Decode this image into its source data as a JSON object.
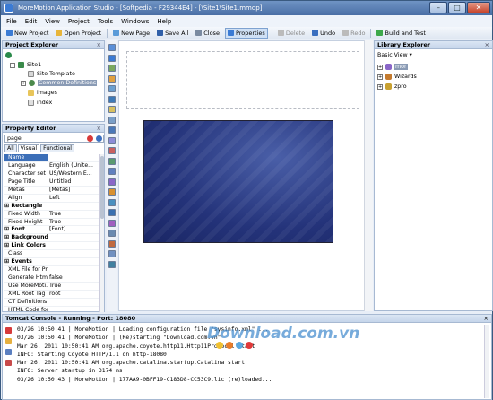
{
  "window": {
    "title": "MoreMotion Application Studio - [Softpedia - F29344E4] - [\\Site1\\Site1.mmdp]"
  },
  "menu": [
    "File",
    "Edit",
    "View",
    "Project",
    "Tools",
    "Windows",
    "Help"
  ],
  "toolbar": [
    {
      "label": "New Project",
      "icon": "new-project-icon",
      "color": "#3b7bd4"
    },
    {
      "label": "Open Project",
      "icon": "open-project-icon",
      "color": "#e8b53a"
    },
    {
      "label": "New Page",
      "icon": "new-page-icon",
      "color": "#5a9bd8"
    },
    {
      "label": "Save All",
      "icon": "save-all-icon",
      "color": "#2f5fa8"
    },
    {
      "label": "Close",
      "icon": "close-doc-icon",
      "color": "#7a8aa0"
    },
    {
      "label": "Properties",
      "icon": "properties-icon",
      "color": "#3b7bd4",
      "active": true
    },
    {
      "label": "Delete",
      "icon": "delete-icon",
      "color": "#bbbbbb",
      "disabled": true
    },
    {
      "label": "Undo",
      "icon": "undo-icon",
      "color": "#3a6fbf"
    },
    {
      "label": "Redo",
      "icon": "redo-icon",
      "color": "#bbbbbb",
      "disabled": true
    },
    {
      "label": "Build and Test",
      "icon": "build-test-icon",
      "color": "#3da84a"
    }
  ],
  "project_explorer": {
    "title": "Project Explorer",
    "close": "×",
    "nodes": [
      {
        "label": "",
        "icon": "globe-icon",
        "color": "#2a8a4a"
      },
      {
        "label": "Site1",
        "icon": "site-icon",
        "color": "#3a8a4a"
      },
      {
        "label": "Site Template",
        "icon": "template-icon",
        "color": "#d8d8d8"
      },
      {
        "label": "Common Definitions",
        "icon": "definitions-icon",
        "color": "#4c8a4c",
        "selected": true
      },
      {
        "label": "images",
        "icon": "folder-icon",
        "color": "#e8c55a"
      },
      {
        "label": "index",
        "icon": "page-icon",
        "color": "#e0e0e0"
      }
    ]
  },
  "property_editor": {
    "title": "Property Editor",
    "close": "×",
    "search": "page",
    "tabs": [
      "All",
      "Visual",
      "Functional"
    ],
    "rows": [
      {
        "name": "Name",
        "value": "",
        "selected": true
      },
      {
        "name": "Language",
        "value": "English (Unite..."
      },
      {
        "name": "Character set",
        "value": "US/Western E..."
      },
      {
        "name": "Page Title",
        "value": "Untitled"
      },
      {
        "name": "Metas",
        "value": "[Metas]"
      },
      {
        "name": "Align",
        "value": "Left"
      },
      {
        "name": "Rectangle",
        "value": "",
        "header": true
      },
      {
        "name": "Fixed Width",
        "value": "True"
      },
      {
        "name": "Fixed Height",
        "value": "True"
      },
      {
        "name": "Font",
        "value": "[Font]",
        "header": true
      },
      {
        "name": "Background",
        "value": "",
        "header": true
      },
      {
        "name": "Link Colors",
        "value": "",
        "header": true
      },
      {
        "name": "Class",
        "value": ""
      },
      {
        "name": "Events",
        "value": "",
        "header": true
      },
      {
        "name": "XML File for Pr...",
        "value": ""
      },
      {
        "name": "Generate Html",
        "value": "false"
      },
      {
        "name": "Use MoreMoti...",
        "value": "True"
      },
      {
        "name": "XML Root Tag ...",
        "value": "root"
      },
      {
        "name": "CT Definitions",
        "value": ""
      },
      {
        "name": "HTML Code for...",
        "value": ""
      }
    ]
  },
  "library_explorer": {
    "title": "Library Explorer",
    "close": "×",
    "view": "Basic View",
    "items": [
      {
        "label": "mor",
        "icon": "library-icon",
        "color": "#8a66c8",
        "selected": true
      },
      {
        "label": "Wizards",
        "icon": "wizard-icon",
        "color": "#c47a2e"
      },
      {
        "label": "zpro",
        "icon": "zpro-icon",
        "color": "#c8a030"
      }
    ]
  },
  "console": {
    "title": "Tomcat Console - Running - Port: 18080",
    "close": "×",
    "lines": [
      "03/26 10:50:41 | MoreMotion | Loading configuration file \"sysinfo.xml\" ...",
      "03/26 10:50:41 | MoreMotion | (Re)starting \"Download.com.vn\"",
      "Mar 26, 2011 10:50:41 AM org.apache.coyote.http11.Http11Protocol start",
      "INFO: Starting Coyote HTTP/1.1 on http-18080",
      "Mar 26, 2011 10:50:41 AM org.apache.catalina.startup.Catalina start",
      "INFO: Server startup in 3174 ms",
      "03/26 10:50:43 | MoreMotion | 177AA9-0BFF19-C183D8-CC53C9.lic (re)loaded..."
    ]
  },
  "watermark": "Download.com.vn"
}
